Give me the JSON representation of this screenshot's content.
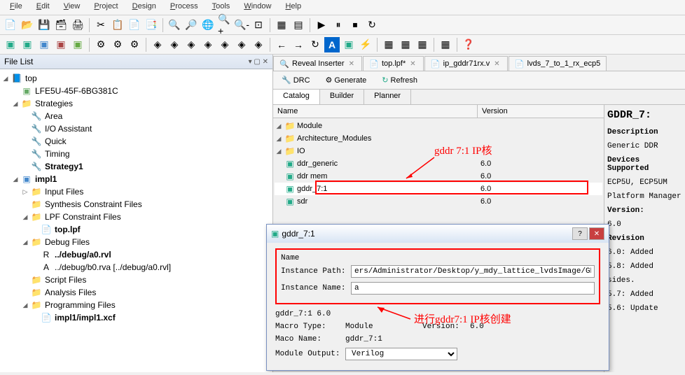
{
  "menu": {
    "file": "File",
    "edit": "Edit",
    "view": "View",
    "project": "Project",
    "design": "Design",
    "process": "Process",
    "tools": "Tools",
    "window": "Window",
    "help": "Help"
  },
  "leftPanel": {
    "title": "File List"
  },
  "tree": {
    "top": "top",
    "device": "LFE5U-45F-6BG381C",
    "strategies": "Strategies",
    "area": "Area",
    "io": "I/O Assistant",
    "quick": "Quick",
    "timing": "Timing",
    "strategy1": "Strategy1",
    "impl1": "impl1",
    "inputFiles": "Input Files",
    "synthCons": "Synthesis Constraint Files",
    "lpfCons": "LPF Constraint Files",
    "toplpf": "top.lpf",
    "debugFiles": "Debug Files",
    "rvl": "../debug/a0.rvl",
    "rva": "../debug/b0.rva [../debug/a0.rvl]",
    "scriptFiles": "Script Files",
    "analysisFiles": "Analysis Files",
    "progFiles": "Programming Files",
    "xcf": "impl1/impl1.xcf"
  },
  "tabs": {
    "reveal": "Reveal Inserter",
    "toplpf": "top.lpf*",
    "ipgddr": "ip_gddr71rx.v",
    "lvds": "lvds_7_to_1_rx_ecp5"
  },
  "ipToolbar": {
    "drc": "DRC",
    "generate": "Generate",
    "refresh": "Refresh"
  },
  "subTabs": {
    "catalog": "Catalog",
    "builder": "Builder",
    "planner": "Planner"
  },
  "catalogHeader": {
    "name": "Name",
    "version": "Version"
  },
  "catalog": {
    "module": "Module",
    "arch": "Architecture_Modules",
    "io": "IO",
    "ddr_generic": {
      "name": "ddr_generic",
      "ver": "6.0"
    },
    "ddr_mem": {
      "name": "ddr mem",
      "ver": "6.0"
    },
    "gddr": {
      "name": "gddr_7:1",
      "ver": "6.0"
    },
    "sdr": {
      "name": "sdr",
      "ver": "6.0"
    }
  },
  "annotation": {
    "top": "gddr 7:1 IP核",
    "dlg": "进行gddr7:1 IP核创建"
  },
  "info": {
    "title": "GDDR_7:",
    "desc_h": "Description",
    "desc": "Generic DDR",
    "dev_h": "Devices Supported",
    "dev": "ECP5U, ECP5UM",
    "plat": "Platform Manager",
    "ver_h": "Version:",
    "ver": "6.0",
    "rev_h": "Revision",
    "r60": "6.0: Added",
    "r58": "5.8: Added",
    "sides": "sides.",
    "r57": "5.7: Added",
    "r56": "5.6: Update"
  },
  "dialog": {
    "title": "gddr_7:1",
    "name_grp": "Name",
    "inst_path_l": "Instance Path:",
    "inst_path": "ers/Administrator/Desktop/y_mdy_lattice_lvdsImage/GDDR/GDDR",
    "inst_name_l": "Instance Name:",
    "inst_name": "a",
    "summary": "gddr_7:1 6.0",
    "macro_type_l": "Macro Type:",
    "macro_type": "Module",
    "version_l": "Version:",
    "version": "6.0",
    "maco_name_l": "Maco Name:",
    "maco_name": "gddr_7:1",
    "mod_out_l": "Module Output:",
    "mod_out": "Verilog"
  }
}
